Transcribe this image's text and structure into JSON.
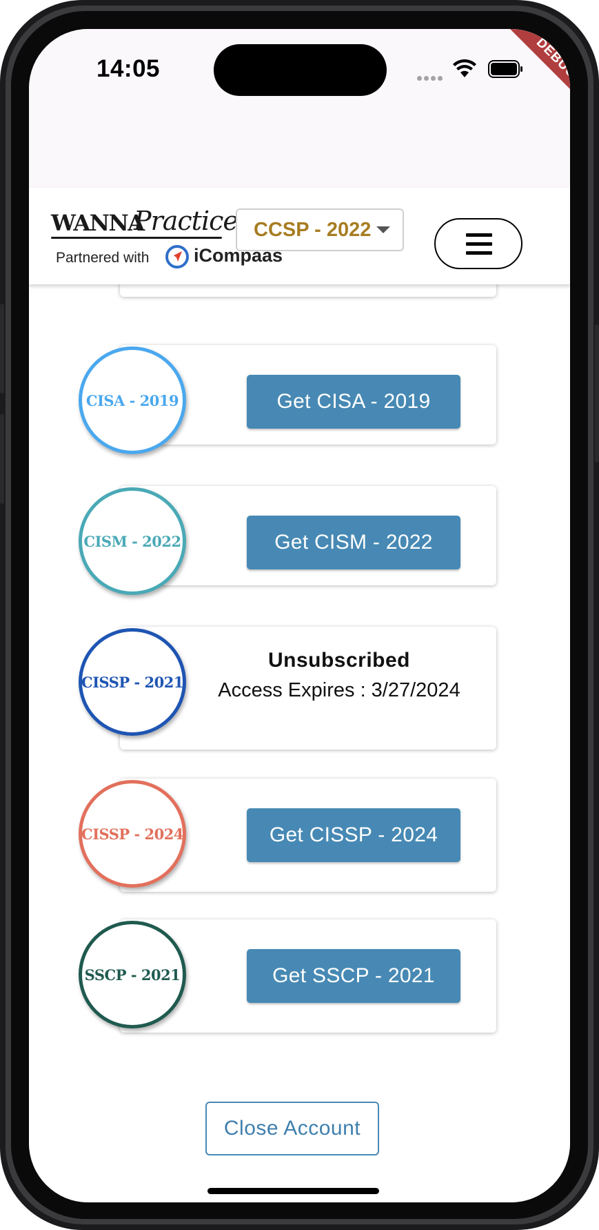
{
  "status_bar": {
    "time": "14:05",
    "debug_label": "DEBUG"
  },
  "header": {
    "logo_wanna": "WANNA",
    "logo_practice": "Practice",
    "partner_prefix": "Partnered with",
    "partner_brand": "iCompaas",
    "cert_selector_value": "CCSP - 2022",
    "menu_icon": "hamburger-menu-icon"
  },
  "certifications": [
    {
      "badge": "CISA - 2019",
      "badge_color": "#4aa8ee",
      "action_label": "Get CISA - 2019"
    },
    {
      "badge": "CISM - 2022",
      "badge_color": "#4aa9b6",
      "action_label": "Get CISM - 2022"
    },
    {
      "badge": "CISSP - 2021",
      "badge_color": "#1e55b3",
      "status_title": "Unsubscribed",
      "status_detail": "Access Expires : 3/27/2024"
    },
    {
      "badge": "CISSP - 2024",
      "badge_color": "#e2705c",
      "action_label": "Get CISSP - 2024"
    },
    {
      "badge": "SSCP - 2021",
      "badge_color": "#1f5a4f",
      "action_label": "Get SSCP - 2021"
    }
  ],
  "footer": {
    "close_account_label": "Close Account"
  },
  "colors": {
    "primary_button": "#4789b4",
    "selector_text": "#a77d22",
    "debug_ribbon": "#b13e3f"
  }
}
